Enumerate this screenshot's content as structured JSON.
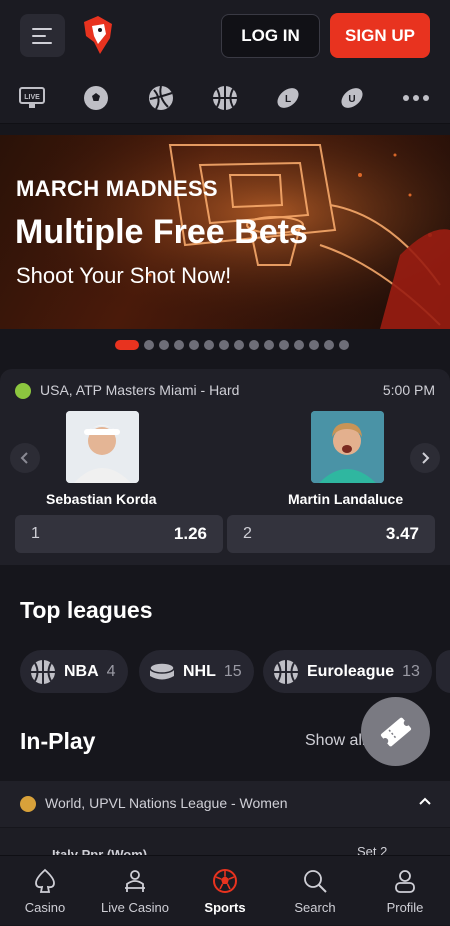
{
  "header": {
    "login_label": "LOG IN",
    "signup_label": "SIGN UP"
  },
  "sports_icons": [
    "live-icon",
    "soccer-icon",
    "volleyball-icon",
    "basketball-icon",
    "rugby-ball-icon",
    "american-football-icon",
    "more-icon"
  ],
  "banner": {
    "subtitle": "MARCH MADNESS",
    "title": "Multiple Free Bets",
    "tagline": "Shoot Your Shot Now!"
  },
  "carousel": {
    "total": 15,
    "active_index": 0
  },
  "match": {
    "league": "USA, ATP Masters Miami - Hard",
    "time": "5:00 PM",
    "player1": "Sebastian Korda",
    "player2": "Martin Landaluce",
    "odds": [
      {
        "key": "1",
        "value": "1.26"
      },
      {
        "key": "2",
        "value": "3.47"
      }
    ]
  },
  "top_leagues": {
    "title": "Top leagues",
    "items": [
      {
        "label": "NBA",
        "count": "4"
      },
      {
        "label": "NHL",
        "count": "15"
      },
      {
        "label": "Euroleague",
        "count": "13"
      }
    ]
  },
  "in_play": {
    "title": "In-Play",
    "show_all": "Show all",
    "league": "World, UPVL Nations League - Women",
    "peek_team": "Italy Ppr (Wom)",
    "peek_set": "Set 2"
  },
  "bottom_nav": [
    {
      "label": "Casino"
    },
    {
      "label": "Live Casino"
    },
    {
      "label": "Sports"
    },
    {
      "label": "Search"
    },
    {
      "label": "Profile"
    }
  ],
  "colors": {
    "accent": "#e8331f",
    "background": "#16161c",
    "card": "#202028"
  }
}
